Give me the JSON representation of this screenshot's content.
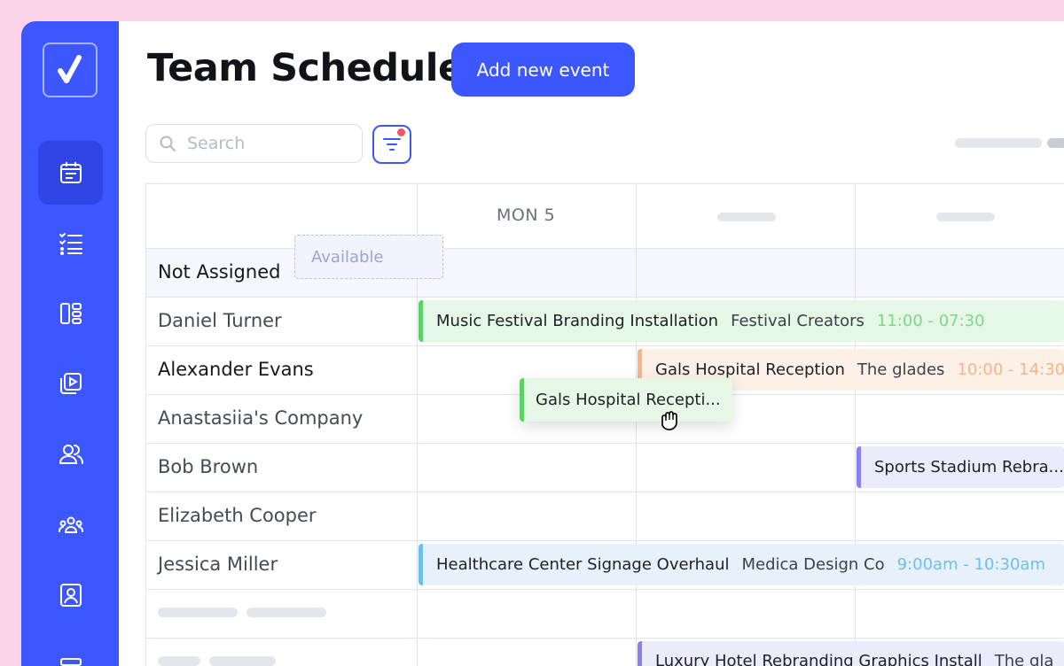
{
  "header": {
    "title": "Team Schedule",
    "add_button_label": "Add new event"
  },
  "toolbar": {
    "search_placeholder": "Search",
    "filter_has_notification": true
  },
  "sidebar": {
    "items": [
      {
        "icon": "calendar-icon",
        "active": true
      },
      {
        "icon": "checklist-icon",
        "active": false
      },
      {
        "icon": "layout-icon",
        "active": false
      },
      {
        "icon": "video-library-icon",
        "active": false
      },
      {
        "icon": "users-icon",
        "active": false
      },
      {
        "icon": "team-icon",
        "active": false
      },
      {
        "icon": "contact-card-icon",
        "active": false
      },
      {
        "icon": "stack-icon",
        "active": false
      }
    ]
  },
  "schedule": {
    "day_label": "MON 5",
    "rows": [
      {
        "name": "Not Assigned"
      },
      {
        "name": "Daniel Turner"
      },
      {
        "name": "Alexander Evans"
      },
      {
        "name": "Anastasiia's Company"
      },
      {
        "name": "Bob Brown"
      },
      {
        "name": "Elizabeth Cooper"
      },
      {
        "name": "Jessica Miller"
      }
    ],
    "events": [
      {
        "title": "Music Festival Branding Installation",
        "client": "Festival Creators",
        "time": "11:00 - 07:30"
      },
      {
        "title": "Gals Hospital Reception",
        "client": "The glades",
        "time": "10:00 - 14:30"
      },
      {
        "title": "Sports Stadium Rebra..."
      },
      {
        "title": "Healthcare Center Signage Overhaul",
        "client": "Medica Design Co",
        "time": "9:00am - 10:30am"
      },
      {
        "title": "Luxury Hotel Rebranding Graphics Install",
        "client": "The gla"
      }
    ],
    "available_label": "Available",
    "dragging_label": "Gals Hospital Recepti..."
  },
  "colors": {
    "accent": "#3d57ff",
    "background": "#fbd3e9",
    "event_green": "#5dd069",
    "event_orange": "#f7b486",
    "event_purple": "#8a7ff0",
    "event_blue": "#6ec0ea"
  }
}
